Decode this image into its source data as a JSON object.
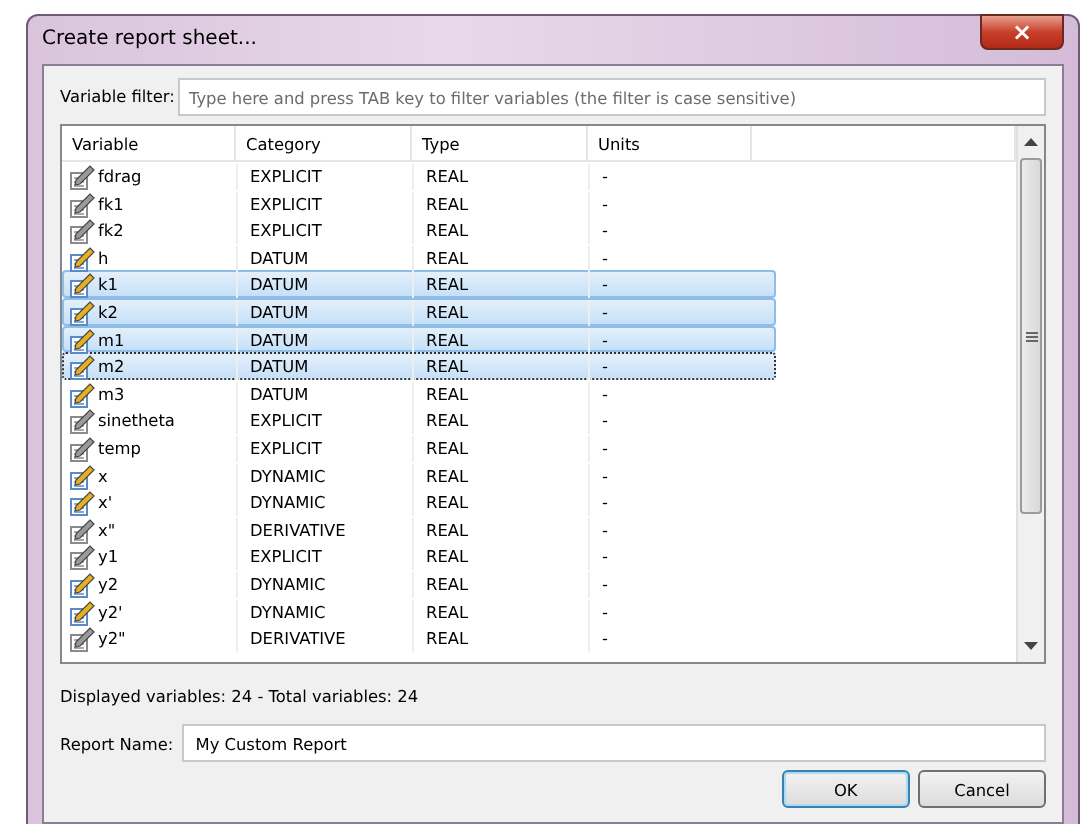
{
  "window": {
    "title": "Create report sheet...",
    "close": "×"
  },
  "filter": {
    "label": "Variable filter:",
    "placeholder": "Type here and press TAB key to filter variables (the filter is case sensitive)"
  },
  "table": {
    "columns": [
      "Variable",
      "Category",
      "Type",
      "Units"
    ],
    "rows": [
      {
        "variable": "fdrag",
        "category": "EXPLICIT",
        "type": "REAL",
        "units": "-",
        "kind": "plain",
        "selected": false,
        "focused": false
      },
      {
        "variable": "fk1",
        "category": "EXPLICIT",
        "type": "REAL",
        "units": "-",
        "kind": "plain",
        "selected": false,
        "focused": false
      },
      {
        "variable": "fk2",
        "category": "EXPLICIT",
        "type": "REAL",
        "units": "-",
        "kind": "plain",
        "selected": false,
        "focused": false
      },
      {
        "variable": "h",
        "category": "DATUM",
        "type": "REAL",
        "units": "-",
        "kind": "color",
        "selected": false,
        "focused": false
      },
      {
        "variable": "k1",
        "category": "DATUM",
        "type": "REAL",
        "units": "-",
        "kind": "color",
        "selected": true,
        "focused": false
      },
      {
        "variable": "k2",
        "category": "DATUM",
        "type": "REAL",
        "units": "-",
        "kind": "color",
        "selected": true,
        "focused": false
      },
      {
        "variable": "m1",
        "category": "DATUM",
        "type": "REAL",
        "units": "-",
        "kind": "color",
        "selected": true,
        "focused": false
      },
      {
        "variable": "m2",
        "category": "DATUM",
        "type": "REAL",
        "units": "-",
        "kind": "color",
        "selected": true,
        "focused": true
      },
      {
        "variable": "m3",
        "category": "DATUM",
        "type": "REAL",
        "units": "-",
        "kind": "color",
        "selected": false,
        "focused": false
      },
      {
        "variable": "sinetheta",
        "category": "EXPLICIT",
        "type": "REAL",
        "units": "-",
        "kind": "plain",
        "selected": false,
        "focused": false
      },
      {
        "variable": "temp",
        "category": "EXPLICIT",
        "type": "REAL",
        "units": "-",
        "kind": "plain",
        "selected": false,
        "focused": false
      },
      {
        "variable": "x",
        "category": "DYNAMIC",
        "type": "REAL",
        "units": "-",
        "kind": "color",
        "selected": false,
        "focused": false
      },
      {
        "variable": "x'",
        "category": "DYNAMIC",
        "type": "REAL",
        "units": "-",
        "kind": "color",
        "selected": false,
        "focused": false
      },
      {
        "variable": "x\"",
        "category": "DERIVATIVE",
        "type": "REAL",
        "units": "-",
        "kind": "plain",
        "selected": false,
        "focused": false
      },
      {
        "variable": "y1",
        "category": "EXPLICIT",
        "type": "REAL",
        "units": "-",
        "kind": "plain",
        "selected": false,
        "focused": false
      },
      {
        "variable": "y2",
        "category": "DYNAMIC",
        "type": "REAL",
        "units": "-",
        "kind": "color",
        "selected": false,
        "focused": false
      },
      {
        "variable": "y2'",
        "category": "DYNAMIC",
        "type": "REAL",
        "units": "-",
        "kind": "color",
        "selected": false,
        "focused": false
      },
      {
        "variable": "y2\"",
        "category": "DERIVATIVE",
        "type": "REAL",
        "units": "-",
        "kind": "plain",
        "selected": false,
        "focused": false
      }
    ]
  },
  "status": "Displayed variables: 24 - Total variables: 24",
  "report_name": {
    "label": "Report Name:",
    "value": "My Custom Report"
  },
  "buttons": [
    {
      "label": "OK",
      "default": true
    },
    {
      "label": "Cancel",
      "default": false
    }
  ]
}
